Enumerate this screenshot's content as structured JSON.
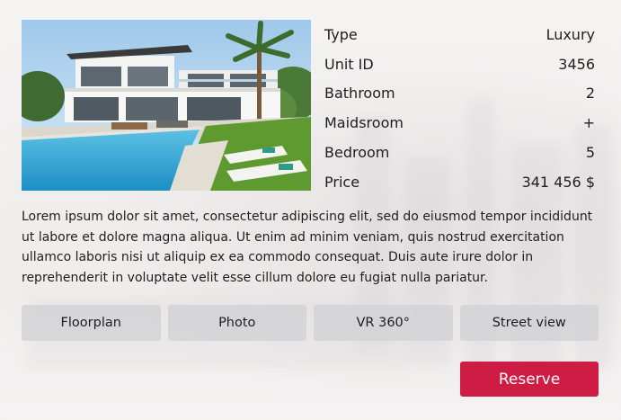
{
  "specs": [
    {
      "label": "Type",
      "value": "Luxury"
    },
    {
      "label": "Unit ID",
      "value": "3456"
    },
    {
      "label": "Bathroom",
      "value": "2"
    },
    {
      "label": "Maidsroom",
      "value": "+"
    },
    {
      "label": "Bedroom",
      "value": "5"
    },
    {
      "label": "Price",
      "value": "341 456 $"
    }
  ],
  "description": "Lorem ipsum dolor sit amet, consectetur adipiscing elit, sed do eiusmod tempor incididunt ut labore et dolore magna aliqua. Ut enim ad minim veniam, quis nostrud exercitation ullamco laboris nisi ut aliquip ex ea commodo consequat. Duis aute irure dolor in reprehenderit in voluptate velit esse cillum dolore eu fugiat nulla pariatur.",
  "tabs": [
    {
      "label": "Floorplan"
    },
    {
      "label": "Photo"
    },
    {
      "label": "VR 360°"
    },
    {
      "label": "Street view"
    }
  ],
  "reserve_label": "Reserve",
  "colors": {
    "accent": "#cf1c45",
    "tab_bg": "#d2d2d4",
    "text": "#1e1e1e"
  }
}
